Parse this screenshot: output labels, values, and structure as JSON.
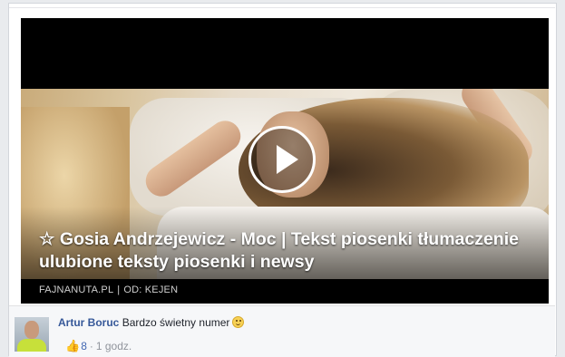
{
  "post": {
    "video": {
      "title": "☆ Gosia Andrzejewicz - Moc | Tekst piosenki tłumaczenie ulubione teksty piosenki i newsy",
      "domain": "FAJNANUTA.PL",
      "separator": "|",
      "from": "OD: KEJEN"
    }
  },
  "comment": {
    "author": "Artur Boruc",
    "text": "Bardzo świetny numer",
    "likes": "8",
    "time": "1 godz."
  },
  "icons": {
    "play": "play-icon",
    "like": "thumbs-up-icon",
    "emoji": "smiley-icon"
  },
  "colors": {
    "link": "#365899",
    "like": "#4267b2",
    "meta": "#90949c"
  }
}
